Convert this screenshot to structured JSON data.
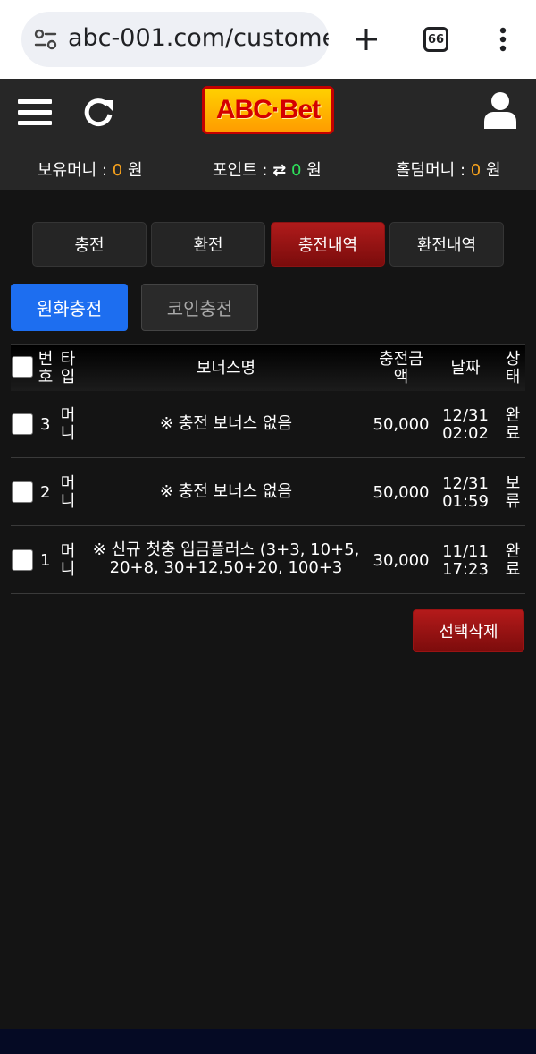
{
  "browser": {
    "url": "abc-001.com/custome",
    "tab_count": "66"
  },
  "header": {
    "logo_text": "ABC·Bet",
    "balances": {
      "hold_label": "보유머니 :",
      "hold_value": "0",
      "point_label": "포인트 :",
      "point_value": "0",
      "holdem_label": "홀덤머니 :",
      "holdem_value": "0",
      "unit": "원"
    }
  },
  "tabs": [
    {
      "label": "충전"
    },
    {
      "label": "환전"
    },
    {
      "label": "충전내역"
    },
    {
      "label": "환전내역"
    }
  ],
  "subtabs": [
    {
      "label": "원화충전"
    },
    {
      "label": "코인충전"
    }
  ],
  "table": {
    "headers": {
      "no_1": "번",
      "no_2": "호",
      "type_1": "타",
      "type_2": "입",
      "bonus": "보너스명",
      "amount_1": "충전금",
      "amount_2": "액",
      "date": "날짜",
      "status_1": "상",
      "status_2": "태"
    },
    "rows": [
      {
        "no": "3",
        "type_1": "머",
        "type_2": "니",
        "bonus_1": "※ 충전 보너스 없음",
        "bonus_2": "",
        "amount": "50,000",
        "date_1": "12/31",
        "date_2": "02:02",
        "status_1": "완",
        "status_2": "료"
      },
      {
        "no": "2",
        "type_1": "머",
        "type_2": "니",
        "bonus_1": "※ 충전 보너스 없음",
        "bonus_2": "",
        "amount": "50,000",
        "date_1": "12/31",
        "date_2": "01:59",
        "status_1": "보",
        "status_2": "류"
      },
      {
        "no": "1",
        "type_1": "머",
        "type_2": "니",
        "bonus_1": "※ 신규 첫충 입금플러스 (3+3, 10+5,",
        "bonus_2": "20+8, 30+12,50+20, 100+3",
        "amount": "30,000",
        "date_1": "11/11",
        "date_2": "17:23",
        "status_1": "완",
        "status_2": "료"
      }
    ]
  },
  "delete_button": "선택삭제",
  "colors": {
    "accent_red": "#a01414",
    "accent_blue": "#1d6ef0",
    "balance_orange": "#f7a21d",
    "point_green": "#2ee05a"
  }
}
